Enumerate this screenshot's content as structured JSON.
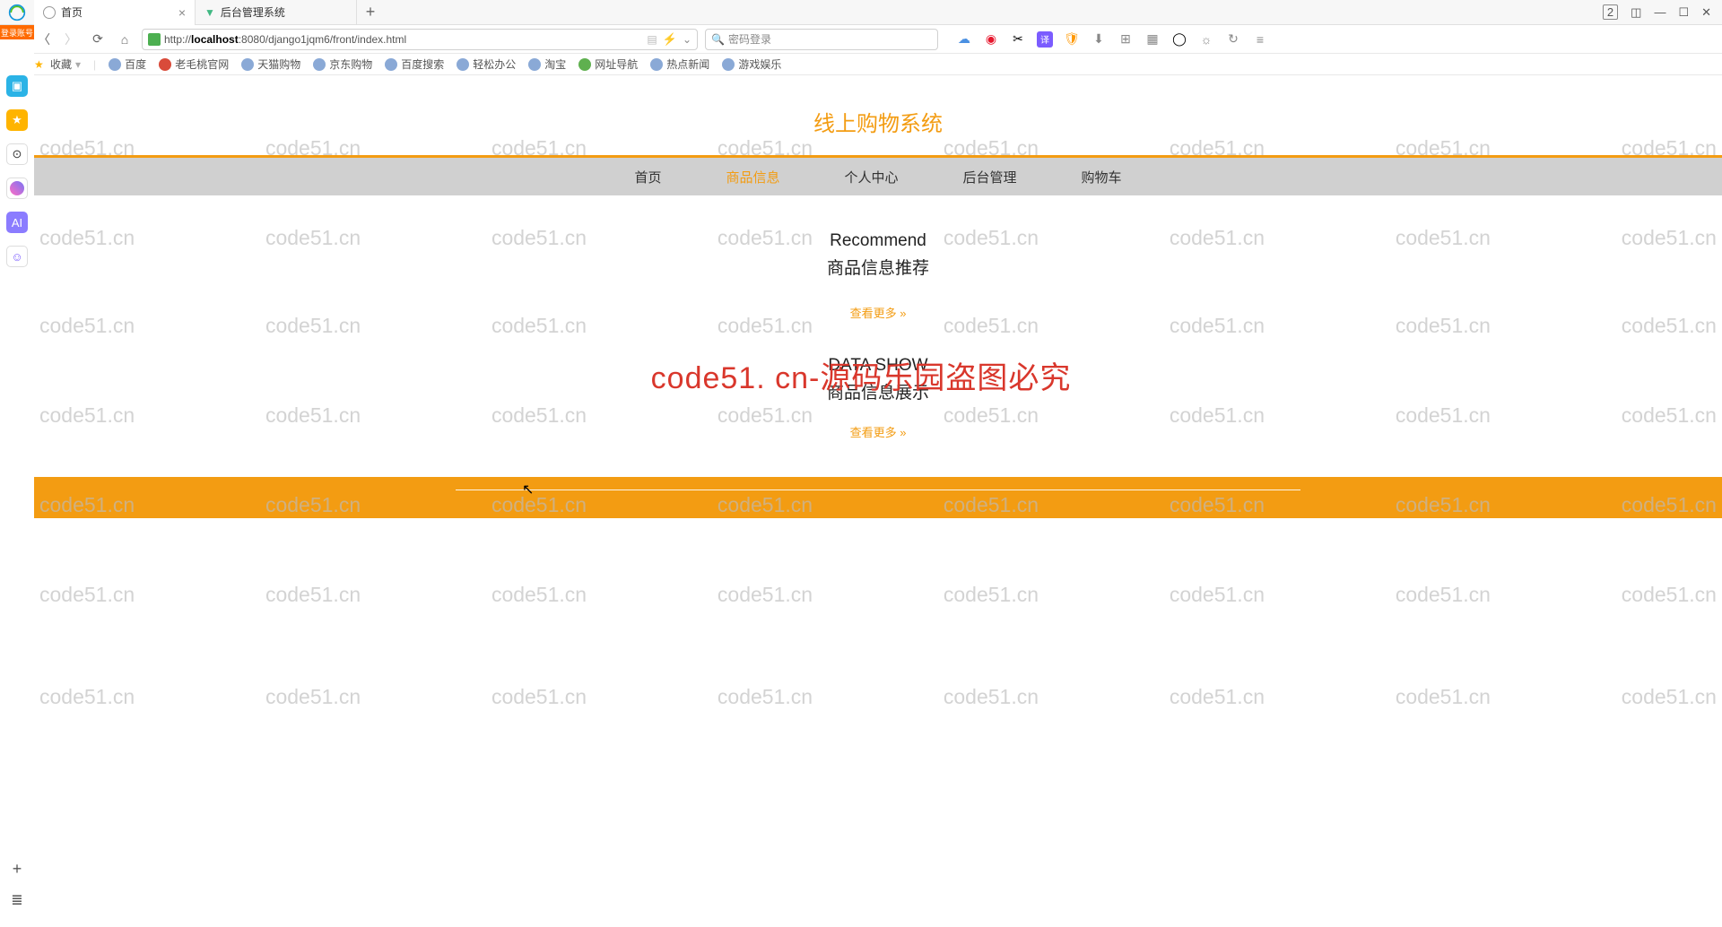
{
  "browser": {
    "tabs": [
      {
        "title": "首页",
        "icon": "globe",
        "active": true
      },
      {
        "title": "后台管理系统",
        "icon": "vue",
        "active": false
      }
    ],
    "tab_count_badge": "2",
    "url_prefix": "http://",
    "url_host": "localhost",
    "url_port_path": ":8080/django1jqm6/front/index.html",
    "search_placeholder": "密码登录"
  },
  "bookmarks": {
    "fav": "收藏",
    "items": [
      "百度",
      "老毛桃官网",
      "天猫购物",
      "京东购物",
      "百度搜索",
      "轻松办公",
      "淘宝",
      "网址导航",
      "热点新闻",
      "游戏娱乐"
    ]
  },
  "dock": {
    "login_badge": "登录账号"
  },
  "site": {
    "title": "线上购物系统",
    "nav": [
      "首页",
      "商品信息",
      "个人中心",
      "后台管理",
      "购物车"
    ],
    "nav_active_index": 1,
    "section1": {
      "en": "Recommend",
      "cn": "商品信息推荐",
      "more": "查看更多"
    },
    "section2": {
      "en": "DATA SHOW",
      "cn": "商品信息展示",
      "more": "查看更多"
    }
  },
  "watermark": {
    "text": "code51.cn",
    "big": "code51. cn-源码乐园盗图必究"
  }
}
